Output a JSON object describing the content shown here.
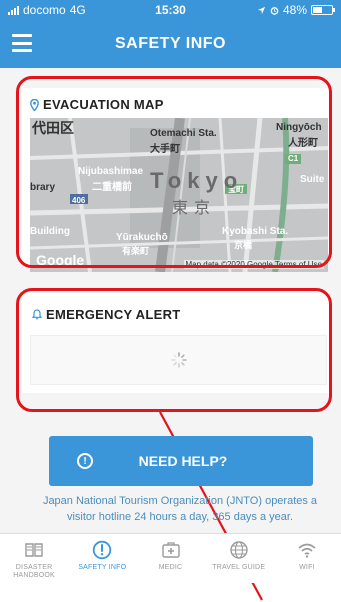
{
  "status_bar": {
    "carrier": "docomo",
    "network": "4G",
    "time": "15:30",
    "battery": "48%",
    "battery_level": 0.48
  },
  "app_bar": {
    "title": "SAFETY INFO",
    "menu_icon": "hamburger-menu-icon"
  },
  "evacuation_map": {
    "title": "EVACUATION MAP",
    "icon": "map-pin-icon",
    "map_labels": {
      "kanji_tl": "代田区",
      "otemachi": "Otemachi Sta.",
      "otemachi_jp": "大手町",
      "nihonbashi": "Nijubashimae",
      "nihonbashi_jp": "二重橋前",
      "ningyocho": "Ningyōch",
      "ningyocho_jp": "人形町",
      "library": "brary",
      "suite": "Suite",
      "tokyo": "Tokyo",
      "tokyo_jp": "東京",
      "route_406": "406",
      "route_c1": "C1",
      "takara": "宝町",
      "building": "Building",
      "yurakucho": "Yūrakuchō",
      "yurakucho_jp": "有楽町",
      "kyobashi": "Kyobashi Sta.",
      "kyobashi_jp": "京橋"
    },
    "google_logo": "Google",
    "attribution": "Map data ©2020 Google   Terms of Use"
  },
  "emergency_alert": {
    "title": "EMERGENCY ALERT",
    "icon": "bell-icon"
  },
  "help_button": {
    "label": "NEED HELP?",
    "icon": "info-circle-icon"
  },
  "info_text": "Japan National Tourism Organization (JNTO) operates a visitor hotline 24 hours a day, 365 days a year.",
  "tabs": [
    {
      "label": "DISASTER HANDBOOK",
      "icon": "book-icon",
      "active": false
    },
    {
      "label": "SAFETY INFO",
      "icon": "alert-circle-icon",
      "active": true
    },
    {
      "label": "MEDIC",
      "icon": "first-aid-icon",
      "active": false
    },
    {
      "label": "TRAVEL GUIDE",
      "icon": "globe-icon",
      "active": false
    },
    {
      "label": "WIFI",
      "icon": "wifi-icon",
      "active": false
    }
  ],
  "colors": {
    "primary": "#3a96d8",
    "annotation": "#e3141b"
  }
}
